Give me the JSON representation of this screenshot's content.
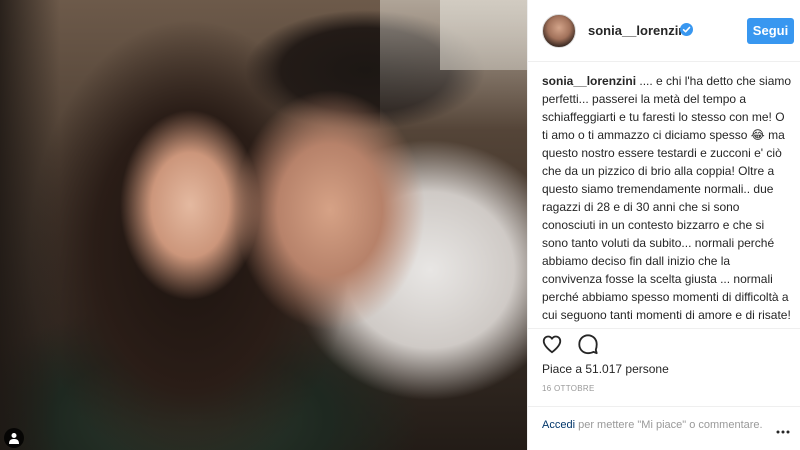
{
  "post": {
    "username": "sonia__lorenzini",
    "follow_label": "Segui",
    "caption_username": "sonia__lorenzini",
    "caption_text": " .... e chi l'ha detto che siamo perfetti... passerei la metà del tempo a schiaffeggiarti e tu faresti lo stesso con me! O ti amo o ti ammazzo ci diciamo spesso 😂 ma questo nostro essere testardi e zucconi e' ciò che da un pizzico di brio alla coppia! Oltre a questo siamo tremendamente normali.. due ragazzi di 28 e di 30 anni che si sono conosciuti in un contesto bizzarro e che si sono tanto voluti da subito... normali perché abbiamo deciso fin dall inizio che la convivenza fosse la scelta giusta ... normali perché abbiamo spesso momenti di difficoltà a cui seguono tanti momenti di amore e di risate! Normali perché L'AMORE NON E' UNA COSA",
    "likes_text": "Piace a 51.017 persone",
    "date": "16 OTTOBRE",
    "login_link": "Accedi",
    "login_rest": " per mettere \"Mi piace\" o commentare."
  },
  "icons": {
    "like": "heart-outline-icon",
    "comment": "comment-bubble-icon",
    "more": "more-options-icon",
    "verified": "verified-badge-icon",
    "tag": "user-tag-icon"
  },
  "colors": {
    "accent": "#3897f0",
    "verified": "#3897f0",
    "link": "#003569",
    "muted": "#999999"
  }
}
